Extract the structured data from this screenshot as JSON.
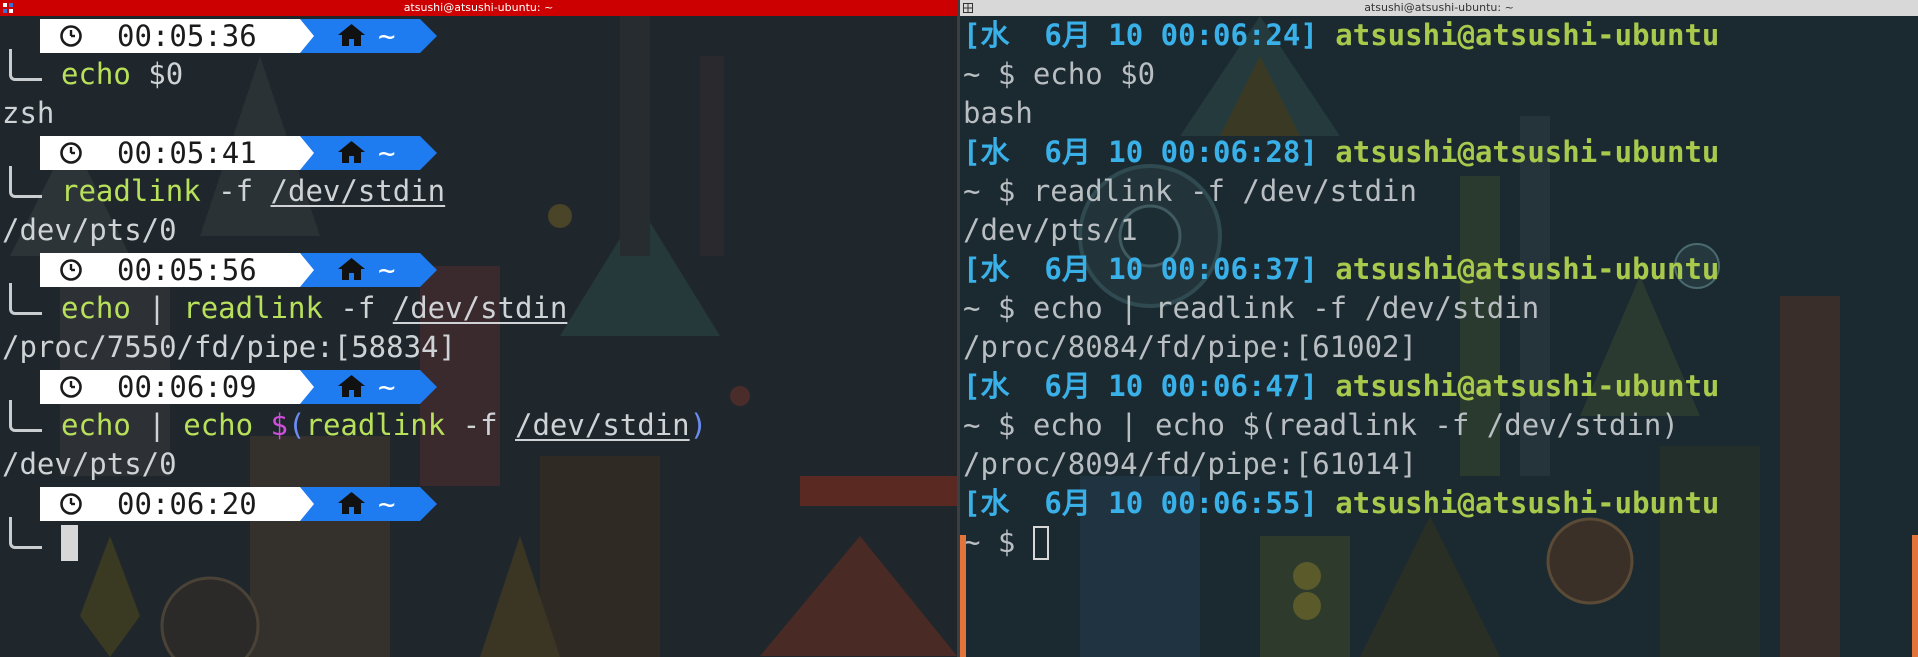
{
  "left_pane": {
    "title": "atsushi@atsushi-ubuntu: ~",
    "blocks": [
      {
        "time": "00:05:36",
        "home": "~",
        "command": [
          {
            "text": "echo",
            "style": "cmd"
          },
          {
            "text": " $0",
            "style": "plain"
          }
        ],
        "output": "zsh"
      },
      {
        "time": "00:05:41",
        "home": "~",
        "command": [
          {
            "text": "readlink",
            "style": "cmd"
          },
          {
            "text": " -f ",
            "style": "plain"
          },
          {
            "text": "/dev/stdin",
            "style": "path"
          }
        ],
        "output": "/dev/pts/0"
      },
      {
        "time": "00:05:56",
        "home": "~",
        "command": [
          {
            "text": "echo",
            "style": "cmd"
          },
          {
            "text": " | ",
            "style": "plain"
          },
          {
            "text": "readlink",
            "style": "cmd"
          },
          {
            "text": " -f ",
            "style": "plain"
          },
          {
            "text": "/dev/stdin",
            "style": "path"
          }
        ],
        "output": "/proc/7550/fd/pipe:[58834]"
      },
      {
        "time": "00:06:09",
        "home": "~",
        "command": [
          {
            "text": "echo",
            "style": "cmd"
          },
          {
            "text": " | ",
            "style": "plain"
          },
          {
            "text": "echo",
            "style": "cmd"
          },
          {
            "text": " ",
            "style": "plain"
          },
          {
            "text": "$",
            "style": "dollar"
          },
          {
            "text": "(",
            "style": "paren"
          },
          {
            "text": "readlink",
            "style": "cmd"
          },
          {
            "text": " -f ",
            "style": "plain"
          },
          {
            "text": "/dev/stdin",
            "style": "path"
          },
          {
            "text": ")",
            "style": "paren"
          }
        ],
        "output": "/dev/pts/0"
      },
      {
        "time": "00:06:20",
        "home": "~",
        "command": [],
        "output": null
      }
    ]
  },
  "right_pane": {
    "title": "atsushi@atsushi-ubuntu: ~",
    "blocks": [
      {
        "date": "[水  6月 10 00:06:24]",
        "user_host": "atsushi@atsushi-ubuntu",
        "prompt": "~ $ ",
        "command": "echo $0",
        "output": "bash"
      },
      {
        "date": "[水  6月 10 00:06:28]",
        "user_host": "atsushi@atsushi-ubuntu",
        "prompt": "~ $ ",
        "command": "readlink -f /dev/stdin",
        "output": "/dev/pts/1"
      },
      {
        "date": "[水  6月 10 00:06:37]",
        "user_host": "atsushi@atsushi-ubuntu",
        "prompt": "~ $ ",
        "command": "echo | readlink -f /dev/stdin",
        "output": "/proc/8084/fd/pipe:[61002]"
      },
      {
        "date": "[水  6月 10 00:06:47]",
        "user_host": "atsushi@atsushi-ubuntu",
        "prompt": "~ $ ",
        "command": "echo | echo $(readlink -f /dev/stdin)",
        "output": "/proc/8094/fd/pipe:[61014]"
      },
      {
        "date": "[水  6月 10 00:06:55]",
        "user_host": "atsushi@atsushi-ubuntu",
        "prompt": "~ $ ",
        "command": "",
        "output": null
      }
    ]
  },
  "colors": {
    "left_titlebar": "#cc0000",
    "right_titlebar": "#d8d8d8",
    "zsh_command": "#b8e05a",
    "zsh_home_segment": "#1e7bf0",
    "bash_date": "#3ab0e8",
    "bash_user_host": "#a9c94c"
  },
  "icons": {
    "time_segment": "clock-icon",
    "home_segment": "home-icon",
    "left_title": "terminal-app-icon",
    "right_title": "tile-layout-icon"
  }
}
